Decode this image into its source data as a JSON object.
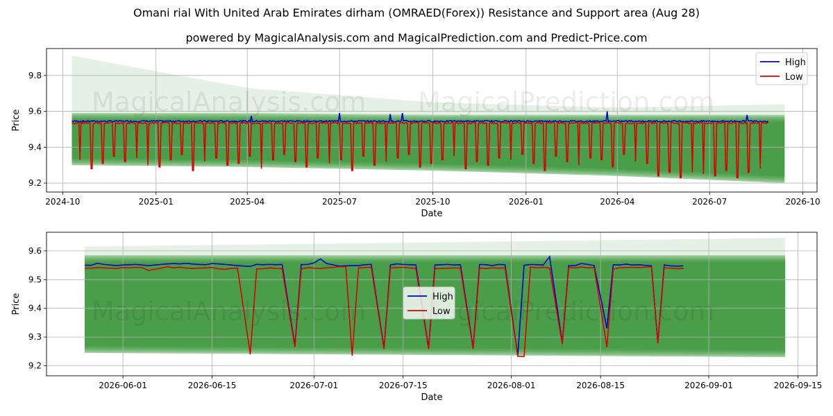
{
  "title": "Omani rial With United Arab Emirates dirham (OMRAED(Forex)) Resistance and Support area (Aug 28)",
  "subtitle": "powered by MagicalAnalysis.com and MagicalPrediction.com and Predict-Price.com",
  "watermark": {
    "left": "MagicalAnalysis.com",
    "right": "MagicalPrediction.com"
  },
  "colors": {
    "high": "#0000cc",
    "low": "#dd0000",
    "band": "#1f8a1f",
    "band_light": "#9fd49f"
  },
  "chart_data": [
    {
      "type": "line",
      "xlabel": "Date",
      "ylabel": "Price",
      "xlim": [
        "2024-09-15",
        "2026-10-15"
      ],
      "ylim": [
        9.15,
        9.95
      ],
      "x_ticks": [
        "2024-10",
        "2025-01",
        "2025-04",
        "2025-07",
        "2025-10",
        "2026-01",
        "2026-04",
        "2026-07",
        "2026-10"
      ],
      "y_ticks": [
        9.2,
        9.4,
        9.6,
        9.8
      ],
      "grid": true,
      "legend": {
        "position": "top-right",
        "entries": [
          "High",
          "Low"
        ]
      },
      "series_range": [
        "2024-10-10",
        "2026-08-28"
      ],
      "band_range": [
        "2024-10-10",
        "2026-09-13"
      ],
      "high_baseline": 9.545,
      "low_baseline": 9.535,
      "high_spikes": [
        {
          "x": "2025-07-01",
          "y": 9.59
        },
        {
          "x": "2025-04-05",
          "y": 9.575
        },
        {
          "x": "2025-08-20",
          "y": 9.585
        },
        {
          "x": "2025-09-01",
          "y": 9.59
        },
        {
          "x": "2026-03-22",
          "y": 9.6
        },
        {
          "x": "2026-08-07",
          "y": 9.58
        }
      ],
      "low_dips": [
        9.33,
        9.28,
        9.31,
        9.35,
        9.32,
        9.34,
        9.3,
        9.29,
        9.33,
        9.36,
        9.27,
        9.32,
        9.34,
        9.3,
        9.31,
        9.35,
        9.28,
        9.33,
        9.36,
        9.32,
        9.29,
        9.34,
        9.31,
        9.33,
        9.27,
        9.35,
        9.3,
        9.32,
        9.34,
        9.36,
        9.29,
        9.31,
        9.33,
        9.35,
        9.28,
        9.32,
        9.3,
        9.34,
        9.33,
        9.36,
        9.31,
        9.27,
        9.35,
        9.32,
        9.3,
        9.34,
        9.33,
        9.29,
        9.36,
        9.32,
        9.31,
        9.24,
        9.26,
        9.23,
        9.26,
        9.25,
        9.24,
        9.27,
        9.23,
        9.26,
        9.28
      ],
      "support_band": [
        {
          "x": "2024-10-10",
          "lower": 9.3,
          "upper": 9.59,
          "outer_upper": 9.91
        },
        {
          "x": "2025-04-01",
          "lower": 9.29,
          "upper": 9.59,
          "outer_upper": 9.73
        },
        {
          "x": "2025-10-01",
          "lower": 9.27,
          "upper": 9.58,
          "outer_upper": 9.65
        },
        {
          "x": "2026-04-01",
          "lower": 9.24,
          "upper": 9.58,
          "outer_upper": 9.62
        },
        {
          "x": "2026-09-13",
          "lower": 9.2,
          "upper": 9.58,
          "outer_upper": 9.64
        }
      ]
    },
    {
      "type": "line",
      "xlabel": "Date",
      "ylabel": "Price",
      "xlim": [
        "2026-05-20",
        "2026-09-18"
      ],
      "ylim": [
        9.165,
        9.665
      ],
      "x_ticks": [
        "2026-06-01",
        "2026-06-15",
        "2026-07-01",
        "2026-07-15",
        "2026-08-01",
        "2026-08-15",
        "2026-09-01",
        "2026-09-15"
      ],
      "y_ticks": [
        9.2,
        9.3,
        9.4,
        9.5,
        9.6
      ],
      "grid": true,
      "legend": {
        "position": "center",
        "entries": [
          "High",
          "Low"
        ]
      },
      "dates": [
        "2026-05-26",
        "2026-05-27",
        "2026-05-28",
        "2026-05-29",
        "2026-05-31",
        "2026-06-01",
        "2026-06-02",
        "2026-06-03",
        "2026-06-04",
        "2026-06-05",
        "2026-06-07",
        "2026-06-08",
        "2026-06-09",
        "2026-06-10",
        "2026-06-11",
        "2026-06-12",
        "2026-06-14",
        "2026-06-15",
        "2026-06-16",
        "2026-06-17",
        "2026-06-18",
        "2026-06-19",
        "2026-06-21",
        "2026-06-22",
        "2026-06-23",
        "2026-06-24",
        "2026-06-25",
        "2026-06-26",
        "2026-06-28",
        "2026-06-29",
        "2026-06-30",
        "2026-07-01",
        "2026-07-02",
        "2026-07-03",
        "2026-07-05",
        "2026-07-06",
        "2026-07-07",
        "2026-07-08",
        "2026-07-09",
        "2026-07-10",
        "2026-07-12",
        "2026-07-13",
        "2026-07-14",
        "2026-07-15",
        "2026-07-16",
        "2026-07-17",
        "2026-07-19",
        "2026-07-20",
        "2026-07-21",
        "2026-07-22",
        "2026-07-23",
        "2026-07-24",
        "2026-07-26",
        "2026-07-27",
        "2026-07-28",
        "2026-07-29",
        "2026-07-30",
        "2026-07-31",
        "2026-08-02",
        "2026-08-03",
        "2026-08-04",
        "2026-08-05",
        "2026-08-06",
        "2026-08-07",
        "2026-08-09",
        "2026-08-10",
        "2026-08-11",
        "2026-08-12",
        "2026-08-13",
        "2026-08-14",
        "2026-08-16",
        "2026-08-17",
        "2026-08-18",
        "2026-08-19",
        "2026-08-20",
        "2026-08-21",
        "2026-08-23",
        "2026-08-24",
        "2026-08-25",
        "2026-08-26",
        "2026-08-27",
        "2026-08-28"
      ],
      "high": [
        9.55,
        9.55,
        9.557,
        9.553,
        9.549,
        9.551,
        9.552,
        9.553,
        9.551,
        9.549,
        9.553,
        9.555,
        9.556,
        9.555,
        9.557,
        9.554,
        9.552,
        9.556,
        9.555,
        9.553,
        9.551,
        9.549,
        9.546,
        9.553,
        9.552,
        9.553,
        9.552,
        9.553,
        9.27,
        9.552,
        9.553,
        9.558,
        9.572,
        9.556,
        9.547,
        9.548,
        9.549,
        9.549,
        9.552,
        9.553,
        9.262,
        9.551,
        9.555,
        9.553,
        9.552,
        9.551,
        9.262,
        9.551,
        9.552,
        9.553,
        9.551,
        9.552,
        9.262,
        9.553,
        9.552,
        9.549,
        9.553,
        9.552,
        9.235,
        9.55,
        9.553,
        9.552,
        9.551,
        9.58,
        9.28,
        9.548,
        9.549,
        9.556,
        9.553,
        9.549,
        9.33,
        9.552,
        9.551,
        9.554,
        9.551,
        9.552,
        9.548,
        9.28,
        9.551,
        9.548,
        9.547,
        9.548
      ],
      "low": [
        9.54,
        9.54,
        9.542,
        9.541,
        9.539,
        9.542,
        9.541,
        9.543,
        9.542,
        9.532,
        9.54,
        9.545,
        9.541,
        9.543,
        9.54,
        9.539,
        9.541,
        9.542,
        9.538,
        9.536,
        9.539,
        9.54,
        9.24,
        9.537,
        9.538,
        9.541,
        9.539,
        9.538,
        9.265,
        9.537,
        9.542,
        9.54,
        9.539,
        9.541,
        9.545,
        9.545,
        9.235,
        9.541,
        9.542,
        9.543,
        9.258,
        9.541,
        9.542,
        9.543,
        9.541,
        9.539,
        9.258,
        9.538,
        9.539,
        9.54,
        9.541,
        9.54,
        9.258,
        9.54,
        9.539,
        9.541,
        9.54,
        9.541,
        9.233,
        9.232,
        9.544,
        9.541,
        9.543,
        9.54,
        9.275,
        9.542,
        9.541,
        9.544,
        9.541,
        9.542,
        9.265,
        9.537,
        9.541,
        9.542,
        9.543,
        9.542,
        9.545,
        9.278,
        9.541,
        9.54,
        9.538,
        9.539
      ],
      "band_range": [
        "2026-05-26",
        "2026-09-13"
      ],
      "support_band": [
        {
          "x": "2026-05-26",
          "lower": 9.245,
          "upper": 9.585,
          "outer_upper": 9.615
        },
        {
          "x": "2026-09-13",
          "lower": 9.23,
          "upper": 9.585,
          "outer_upper": 9.645
        }
      ]
    }
  ]
}
